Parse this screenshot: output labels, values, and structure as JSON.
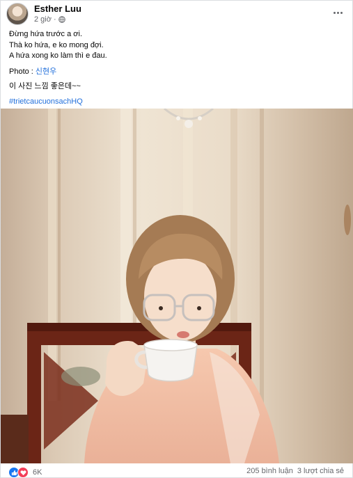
{
  "post": {
    "author": "Esther Luu",
    "time": "2 giờ",
    "lines": [
      "Đừng hứa trước a ơi.",
      "Thà ko hứa, e ko mong đợi.",
      "A hứa xong ko làm thì e đau."
    ],
    "photo_credit_label": "Photo :",
    "photo_credit_name": "신현우",
    "korean_line": "이 사진 느낌 좋은데~~",
    "hashtag": "#trietcaucuonsachHQ"
  },
  "footer": {
    "reaction_count": "6K",
    "comments": "205 bình luận",
    "shares": "3 lượt chia sẻ"
  },
  "colors": {
    "link": "#216fdb",
    "like": "#1877f2",
    "love": "#f33e58",
    "secondary_text": "#65676b"
  },
  "icons": [
    "avatar",
    "globe-icon",
    "more-options-icon",
    "like-reaction-icon",
    "love-reaction-icon"
  ]
}
